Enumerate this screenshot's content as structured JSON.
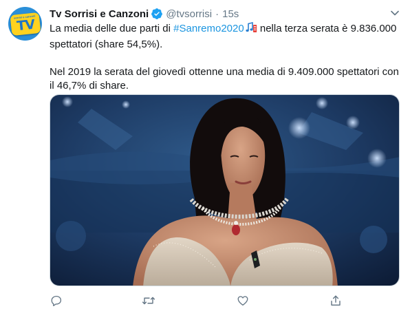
{
  "account": {
    "display_name": "Tv Sorrisi e Canzoni",
    "handle": "@tvsorrisi",
    "separator": "·",
    "time": "15s",
    "avatar_text": "TV",
    "avatar_small_text": "sorrisi e canzoni",
    "verified": true
  },
  "tweet": {
    "line1_before": "La media delle due parti di ",
    "hashtag": "#Sanremo2020",
    "line1_after": " nella terza serata è 9.836.000 spettatori (share 54,5%).",
    "paragraph2": "Nel 2019 la serata del giovedì ottenne una media di 9.409.000 spettatori con il 46,7% di share."
  },
  "media": {
    "type": "photo"
  },
  "actions": [
    {
      "name": "reply",
      "icon": "reply-icon"
    },
    {
      "name": "retweet",
      "icon": "retweet-icon"
    },
    {
      "name": "like",
      "icon": "heart-icon"
    },
    {
      "name": "share",
      "icon": "share-icon"
    }
  ],
  "colors": {
    "link": "#1b95e0",
    "secondary_text": "#657786",
    "primary_text": "#14171a",
    "verified_badge": "#1da1f2"
  }
}
